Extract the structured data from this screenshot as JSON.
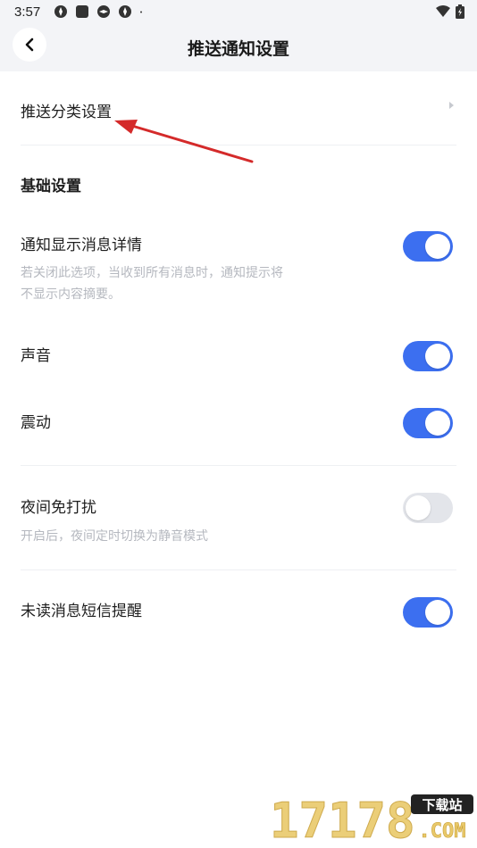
{
  "status_bar": {
    "time": "3:57"
  },
  "header": {
    "title": "推送通知设置"
  },
  "push_category": {
    "label": "推送分类设置"
  },
  "basic_section": {
    "title": "基础设置"
  },
  "settings": {
    "show_detail": {
      "label": "通知显示消息详情",
      "desc": "若关闭此选项，当收到所有消息时，通知提示将不显示内容摘要。",
      "enabled": true
    },
    "sound": {
      "label": "声音",
      "enabled": true
    },
    "vibrate": {
      "label": "震动",
      "enabled": true
    },
    "dnd": {
      "label": "夜间免打扰",
      "desc": "开启后，夜间定时切换为静音模式",
      "enabled": false
    },
    "sms_reminder": {
      "label": "未读消息短信提醒",
      "enabled": true
    }
  },
  "watermark": {
    "number": "17178",
    "tag": "下载站",
    "domain": ".COM"
  },
  "colors": {
    "accent": "#3c6ff0",
    "toggle_off": "#e3e5ea",
    "header_bg": "#f3f4f7",
    "annotation_arrow": "#d42a2a"
  }
}
